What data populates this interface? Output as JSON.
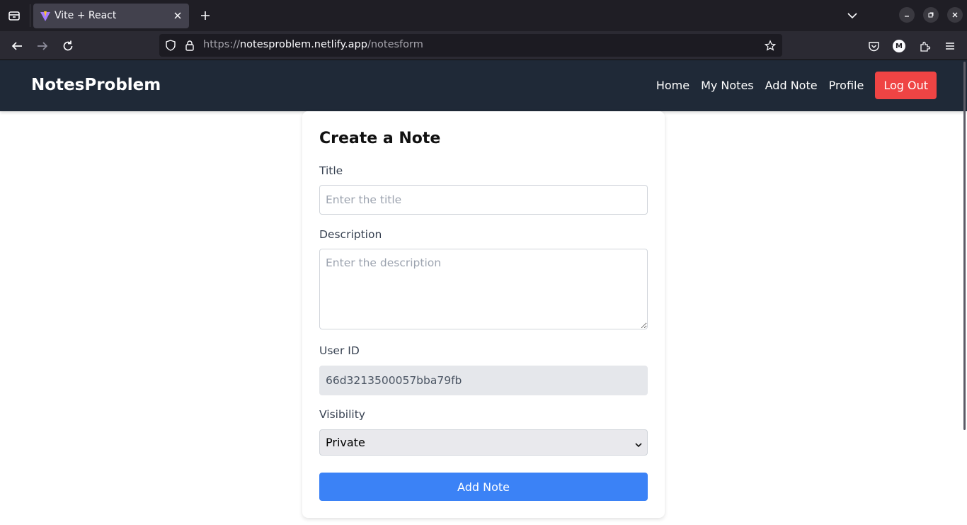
{
  "browser": {
    "tab_title": "Vite + React",
    "url_prefix": "https://",
    "url_host": "notesproblem.netlify.app",
    "url_path": "/notesform",
    "profile_initial": "M"
  },
  "navbar": {
    "brand": "NotesProblem",
    "links": [
      "Home",
      "My Notes",
      "Add Note",
      "Profile"
    ],
    "logout_label": "Log Out"
  },
  "form": {
    "heading": "Create a Note",
    "title_label": "Title",
    "title_placeholder": "Enter the title",
    "description_label": "Description",
    "description_placeholder": "Enter the description",
    "userid_label": "User ID",
    "userid_value": "66d3213500057bba79fb",
    "visibility_label": "Visibility",
    "visibility_value": "Private",
    "submit_label": "Add Note"
  },
  "colors": {
    "navbar_bg": "#1f2937",
    "logout_bg": "#ef4444",
    "submit_bg": "#3b82f6"
  }
}
